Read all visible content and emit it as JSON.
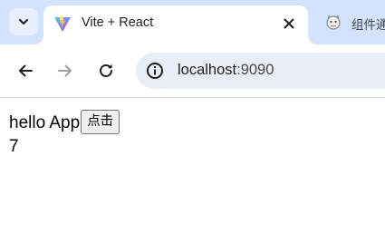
{
  "browser": {
    "active_tab": {
      "title": "Vite + React",
      "favicon": "vite-logo-icon"
    },
    "inactive_tab": {
      "title": "组件通",
      "favicon": "mascot-icon"
    },
    "address_bar": {
      "host": "localhost",
      "port": ":9090"
    },
    "colors": {
      "tabstrip": "#d3e3fd",
      "omnibox": "#e9eef6"
    }
  },
  "page": {
    "hello_text": "hello App",
    "click_button_label": "点击",
    "count": "7"
  }
}
